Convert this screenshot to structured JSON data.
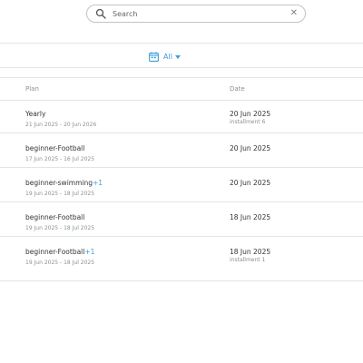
{
  "search": {
    "placeholder": "Search",
    "value": ""
  },
  "icons": {
    "search": "search-icon",
    "clear": "close-icon",
    "calendar": "calendar-icon",
    "caret": "chevron-down-icon"
  },
  "filter": {
    "label": "All"
  },
  "table": {
    "headers": {
      "plan": "Plan",
      "date": "Date"
    },
    "rows": [
      {
        "plan": "Yearly",
        "extra": "",
        "range": "21 Jun 2025 - 20 Jun 2026",
        "date": "20 Jun 2025",
        "sub": "installment 6"
      },
      {
        "plan": "beginner-Football",
        "extra": "",
        "range": "17 Jun 2025 - 16 Jul 2025",
        "date": "20 Jun 2025",
        "sub": ""
      },
      {
        "plan": "beginner-swimming",
        "extra": "+1",
        "range": "19 Jun 2025 - 18 Jul 2025",
        "date": "20 Jun 2025",
        "sub": ""
      },
      {
        "plan": "beginner-Football",
        "extra": "",
        "range": "19 Jun 2025 - 18 Jul 2025",
        "date": "18 Jun 2025",
        "sub": ""
      },
      {
        "plan": "beginner-Football",
        "extra": "+1",
        "range": "19 Jun 2025 - 18 Jul 2025",
        "date": "18 Jun 2025",
        "sub": "installment 1"
      }
    ]
  },
  "colors": {
    "accent": "#3aa0d8",
    "muted_text": "#8a9096",
    "primary_text": "#333333",
    "divider": "#e2e5e8"
  }
}
